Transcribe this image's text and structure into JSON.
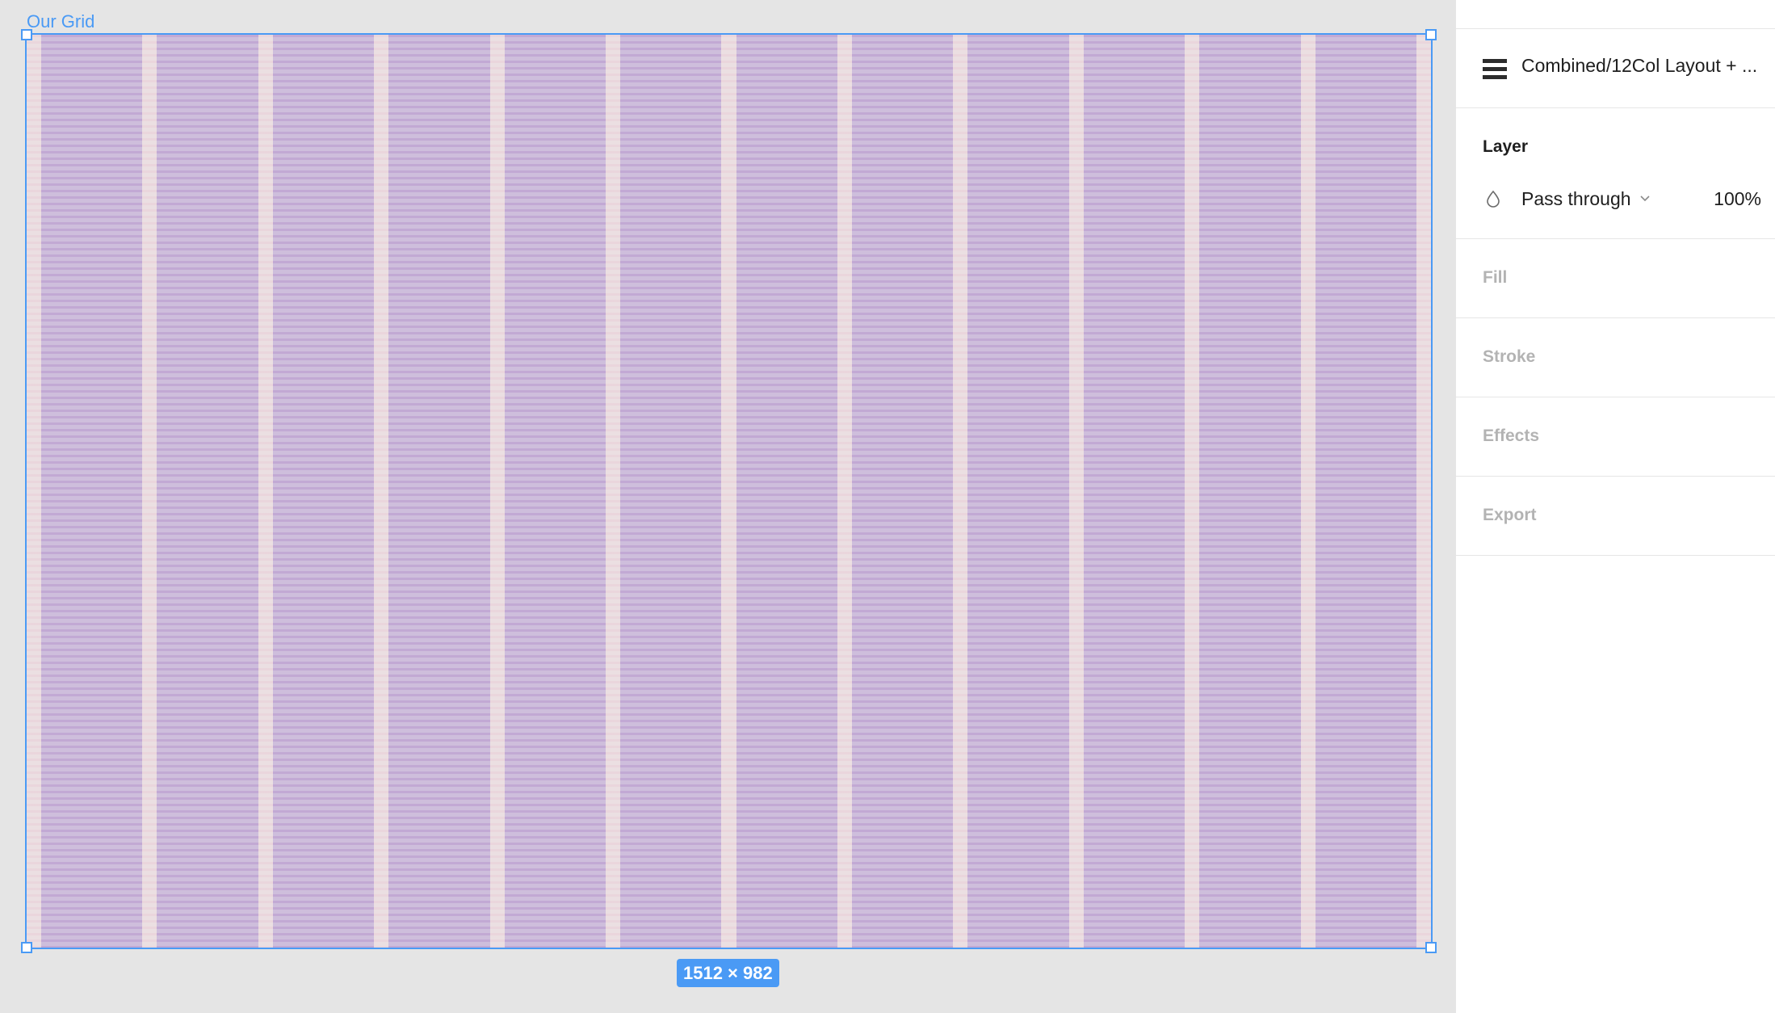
{
  "canvas": {
    "frame_label": "Our Grid",
    "size_badge": "1512 × 982",
    "grid": {
      "columns": 12,
      "column_color": "#cfc0dc",
      "gutter_color": "#ebdfe2",
      "row_stripe_color": "#a896d6"
    },
    "selection_color": "#4a9af5"
  },
  "panel": {
    "component": {
      "icon": "component-hamburger-icon",
      "name": "Combined/12Col Layout + ..."
    },
    "layer": {
      "title": "Layer",
      "blend_icon": "droplet-icon",
      "blend_mode": "Pass through",
      "chevron_icon": "chevron-down-icon",
      "opacity": "100%"
    },
    "sections": {
      "fill": "Fill",
      "stroke": "Stroke",
      "effects": "Effects",
      "export": "Export"
    }
  }
}
